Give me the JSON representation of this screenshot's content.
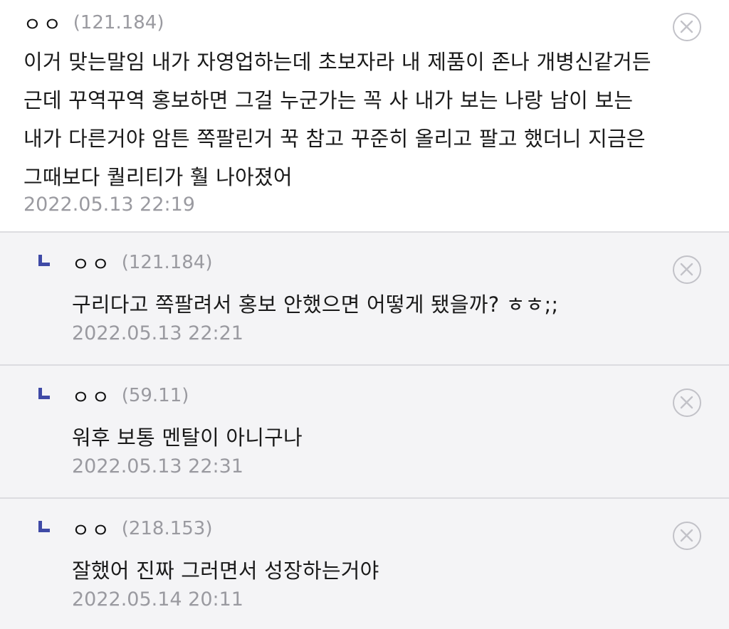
{
  "comments": [
    {
      "nick": "ㅇㅇ",
      "ip": "(121.184)",
      "text": "이거 맞는말임 내가 자영업하는데 초보자라 내 제품이 존나 개병신같거든\n근데 꾸역꾸역 홍보하면 그걸 누군가는 꼭 사 내가 보는 나랑 남이 보는\n내가 다른거야 암튼 쪽팔린거 꾹 참고 꾸준히 올리고 팔고 했더니 지금은\n그때보다 퀄리티가 훨 나아졌어",
      "date": "2022.05.13 22:19"
    },
    {
      "nick": "ㅇㅇ",
      "ip": "(121.184)",
      "text": "구리다고 쪽팔려서 홍보 안했으면 어떻게 됐을까? ㅎㅎ;;",
      "date": "2022.05.13 22:21"
    },
    {
      "nick": "ㅇㅇ",
      "ip": "(59.11)",
      "text": "워후 보통 멘탈이 아니구나",
      "date": "2022.05.13 22:31"
    },
    {
      "nick": "ㅇㅇ",
      "ip": "(218.153)",
      "text": "잘했어 진짜 그러면서 성장하는거야",
      "date": "2022.05.14 20:11"
    }
  ],
  "icons": {
    "delete": "delete-circle-x-icon",
    "reply": "reply-corner-icon"
  },
  "colors": {
    "reply_mark": "#3f4aa6",
    "meta_gray": "#9a9aa0",
    "reply_bg": "#f4f4f6",
    "divider": "#dcdce0"
  }
}
